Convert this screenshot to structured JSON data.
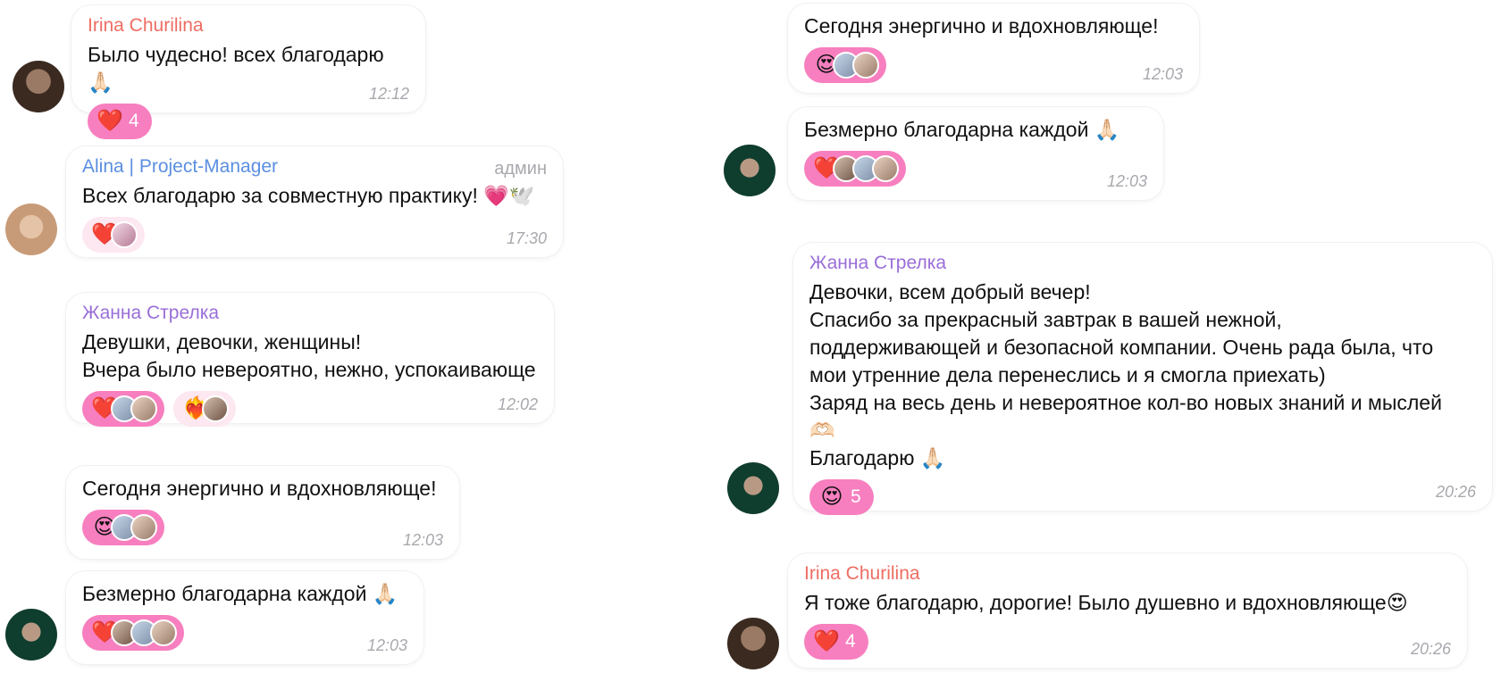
{
  "left": {
    "msg1": {
      "author": "Irina Churilina",
      "text": "Было чудесно! всех благодарю🙏🏻",
      "react_count": "4",
      "time": "12:12"
    },
    "msg2": {
      "author": "Alina | Project-Manager",
      "badge": "админ",
      "text": "Всех благодарю за совместную практику! 💗🕊️",
      "time": "17:30"
    },
    "msg3": {
      "author": "Жанна Стрелка",
      "text": "Девушки, девочки, женщины!\nВчера было невероятно, нежно, успокаивающе",
      "time": "12:02"
    },
    "msg4": {
      "text": "Сегодня энергично и вдохновляюще!",
      "time": "12:03"
    },
    "msg5": {
      "text": "Безмерно благодарна каждой 🙏🏻",
      "time": "12:03"
    }
  },
  "right": {
    "msg1": {
      "text": "Сегодня энергично и вдохновляюще!",
      "time": "12:03"
    },
    "msg2": {
      "text": "Безмерно благодарна каждой 🙏🏻",
      "time": "12:03"
    },
    "msg3": {
      "author": "Жанна Стрелка",
      "text": "Девочки, всем добрый вечер!\nСпасибо за прекрасный завтрак в вашей нежной,\nподдерживающей и безопасной компании. Очень рада была, что\nмои утренние дела перенеслись и я смогла приехать)\nЗаряд на весь день и невероятное кол-во новых знаний и мыслей\n🫶🏻\nБлагодарю 🙏🏻",
      "react_count": "5",
      "time": "20:26"
    },
    "msg4": {
      "author": "Irina Churilina",
      "text": "Я тоже благодарю, дорогие! Было душевно и вдохновляюще😍",
      "react_count": "4",
      "time": "20:26"
    }
  },
  "icons": {
    "heart": "❤️",
    "heart_eyes": "😍",
    "fire_heart": "❤️‍🔥"
  },
  "colors": {
    "reaction_bg": "#f77fbf",
    "name_red": "#ee6d63",
    "name_blue": "#5b8fe0",
    "name_purple": "#9a6ed8",
    "time": "#a8a8ae"
  }
}
